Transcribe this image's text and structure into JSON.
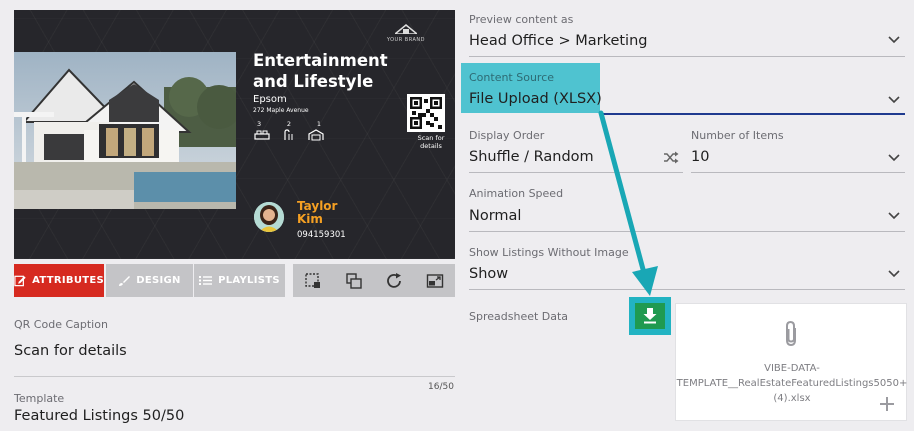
{
  "preview": {
    "brand_name": "YOUR BRAND",
    "listing_title": "Entertainment and Lifestyle",
    "suburb": "Epsom",
    "address": "272 Maple Avenue",
    "bedrooms": "3",
    "bathrooms": "2",
    "garages": "1",
    "qr_caption": "Scan for details",
    "agent_first": "Taylor",
    "agent_last": "Kim",
    "agent_phone": "094159301"
  },
  "toolbar": {
    "attributes_label": "ATTRIBUTES",
    "design_label": "DESIGN",
    "playlists_label": "PLAYLISTS",
    "tools": [
      "select-area-icon",
      "layers-icon",
      "refresh-icon",
      "expand-screen-icon"
    ]
  },
  "left_form": {
    "qr_label": "QR Code Caption",
    "qr_value": "Scan for details",
    "char_count": "16/50",
    "template_label": "Template",
    "template_value": "Featured Listings 50/50"
  },
  "right_form": {
    "preview_label": "Preview content as",
    "preview_value": "Head Office > Marketing",
    "source_label": "Content Source",
    "source_value": "File Upload (XLSX)",
    "order_label": "Display Order",
    "order_value": "Shuffle / Random",
    "items_label": "Number of Items",
    "items_value": "10",
    "anim_label": "Animation Speed",
    "anim_value": "Normal",
    "show_label": "Show Listings Without Image",
    "show_value": "Show",
    "sheet_label": "Spreadsheet Data",
    "file_line1": "VIBE-DATA-",
    "file_line2": "TEMPLATE__RealEstateFeaturedListings5050+",
    "file_line3": "(4).xlsx"
  },
  "colors": {
    "accent_red": "#d62a20",
    "highlight_teal": "#4fc3d0",
    "arrow_teal": "#19a7b5",
    "download_green": "#1f9a50",
    "agent_orange": "#f5a023"
  }
}
